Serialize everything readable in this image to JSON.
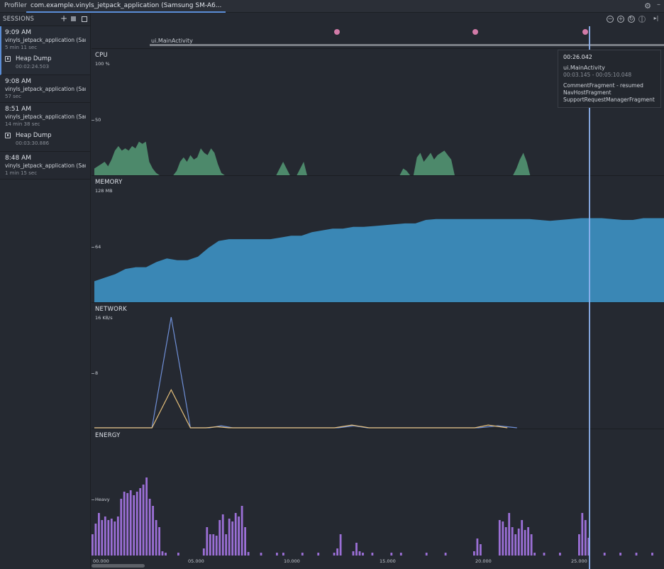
{
  "tabbar": {
    "tool_label": "Profiler",
    "session_tab": "com.example.vinyls_jetpack_application (Samsung SM-A6..."
  },
  "sidebar": {
    "title": "SESSIONS",
    "sessions": [
      {
        "time": "9:09 AM",
        "name": "vinyls_jetpack_application (Sams...",
        "duration": "5 min 11 sec",
        "artifact": {
          "title": "Heap Dump",
          "time": "00:02:24.503"
        }
      },
      {
        "time": "9:08 AM",
        "name": "vinyls_jetpack_application (Sam...",
        "duration": "57 sec"
      },
      {
        "time": "8:51 AM",
        "name": "vinyls_jetpack_application (Sam...",
        "duration": "14 min 38 sec",
        "artifact": {
          "title": "Heap Dump",
          "time": "00:03:30.886"
        }
      },
      {
        "time": "8:48 AM",
        "name": "vinyls_jetpack_application (Sam...",
        "duration": "1 min 15 sec"
      }
    ]
  },
  "events": {
    "activity_label": "ui.MainActivity"
  },
  "lanes": {
    "cpu": {
      "title": "CPU",
      "max_label": "100 %",
      "mid_label": "50",
      "color": "#4f8e6f"
    },
    "memory": {
      "title": "MEMORY",
      "max_label": "128 MB",
      "mid_label": "64",
      "color": "#3a87b5"
    },
    "network": {
      "title": "NETWORK",
      "max_label": "16 KB/s",
      "mid_label": "8",
      "rx_color": "#6f8fd6",
      "tx_color": "#e6c07b"
    },
    "energy": {
      "title": "ENERGY",
      "level_label": "Heavy",
      "color": "#9b6fd6"
    }
  },
  "time_axis": [
    "00.000",
    "05.000",
    "10.000",
    "15.000",
    "20.000",
    "25.000"
  ],
  "tooltip": {
    "time": "00:26.042",
    "activity": "ui.MainActivity",
    "range": "00:03.145 - 00:05:10.048",
    "fragments": [
      "CommentFragment - resumed",
      "NavHostFragment",
      "SupportRequestManagerFragment"
    ]
  },
  "series": {
    "cpu": [
      6,
      8,
      10,
      12,
      8,
      14,
      22,
      26,
      22,
      24,
      22,
      26,
      24,
      30,
      28,
      30,
      12,
      6,
      2,
      0,
      0,
      0,
      0,
      0,
      4,
      12,
      16,
      12,
      18,
      14,
      16,
      24,
      20,
      18,
      24,
      20,
      10,
      2,
      0,
      0,
      0,
      0,
      0,
      0,
      0,
      0,
      0,
      0,
      0,
      0,
      0,
      0,
      0,
      0,
      6,
      12,
      6,
      0,
      0,
      0,
      6,
      12,
      0,
      0,
      0,
      0,
      0,
      0,
      0,
      0,
      0,
      0,
      0,
      0,
      0,
      0,
      0,
      0,
      0,
      0,
      0,
      0,
      0,
      0,
      0,
      0,
      0,
      0,
      0,
      0,
      6,
      4,
      0,
      0,
      16,
      20,
      12,
      16,
      20,
      14,
      18,
      20,
      22,
      18,
      14,
      0,
      0,
      0,
      0,
      0,
      0,
      0,
      0,
      0,
      0,
      0,
      0,
      0,
      0,
      0,
      0,
      0,
      0,
      6,
      14,
      20,
      12,
      0,
      0,
      0,
      0,
      0,
      0,
      0,
      0,
      0,
      0,
      0,
      0,
      0,
      0,
      0,
      0,
      0,
      0,
      0,
      0,
      0,
      0,
      0,
      0,
      0,
      0,
      0,
      0,
      0,
      0,
      0,
      0,
      0,
      0,
      0,
      0,
      0,
      0,
      0,
      0
    ],
    "memory": [
      24,
      28,
      32,
      38,
      40,
      40,
      46,
      50,
      48,
      48,
      52,
      62,
      70,
      72,
      72,
      72,
      72,
      72,
      74,
      76,
      76,
      80,
      82,
      84,
      84,
      86,
      86,
      87,
      88,
      89,
      90,
      90,
      94,
      95,
      95,
      95,
      95,
      95,
      95,
      95,
      95,
      95,
      95,
      94,
      93,
      94,
      95,
      96,
      96,
      96,
      95,
      94,
      94,
      96,
      96,
      96
    ],
    "energy": [
      30,
      45,
      60,
      50,
      55,
      50,
      52,
      48,
      55,
      80,
      90,
      88,
      92,
      85,
      90,
      95,
      100,
      110,
      80,
      70,
      50,
      40,
      6,
      4,
      0,
      0,
      0,
      4,
      0,
      0,
      0,
      0,
      0,
      0,
      0,
      10,
      40,
      30,
      30,
      28,
      50,
      58,
      30,
      52,
      48,
      60,
      55,
      70,
      40,
      5,
      0,
      0,
      0,
      4,
      0,
      0,
      0,
      0,
      4,
      0,
      4,
      0,
      0,
      0,
      0,
      0,
      4,
      0,
      0,
      0,
      0,
      4,
      0,
      0,
      0,
      0,
      4,
      10,
      30,
      0,
      0,
      0,
      6,
      18,
      6,
      4,
      0,
      0,
      4,
      0,
      0,
      0,
      0,
      0,
      4,
      0,
      0,
      4,
      0,
      0,
      0,
      0,
      0,
      0,
      0,
      4,
      0,
      0,
      0,
      0,
      0,
      4,
      0,
      0,
      0,
      0,
      0,
      0,
      0,
      0,
      6,
      24,
      16,
      0,
      0,
      0,
      0,
      0,
      50,
      48,
      40,
      60,
      40,
      30,
      38,
      50,
      36,
      40,
      30,
      4,
      0,
      0,
      4,
      0,
      0,
      0,
      0,
      4,
      0,
      0,
      0,
      0,
      0,
      30,
      60,
      50,
      25,
      0,
      0,
      0,
      0,
      4,
      0,
      0,
      0,
      0,
      4,
      0,
      0,
      0,
      0,
      4,
      0,
      0,
      0,
      0,
      4,
      0,
      0,
      0
    ]
  }
}
